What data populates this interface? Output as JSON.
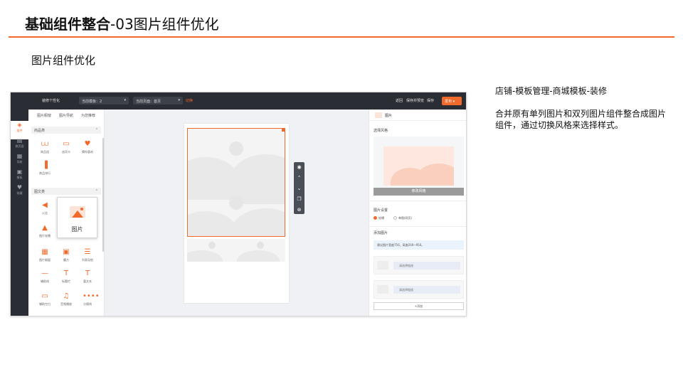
{
  "slide": {
    "title_bold": "基础组件整合",
    "title_rest": "-03图片组件优化",
    "subtitle": "图片组件优化"
  },
  "notes": {
    "path": "店铺-模板管理-商城模板-装修",
    "description": "合并原有单列图片和双列图片组件整合成图片组件，通过切换风格来选择样式。"
  },
  "topbar": {
    "brand": "装修个性化",
    "template_select": "当前模板：2",
    "page_select": "当前页面：首页",
    "switch": "切换",
    "actions": [
      "返回",
      "保存并预览",
      "保存"
    ],
    "publish": "发布 ▾"
  },
  "iconbar": [
    {
      "icon": "cart-icon",
      "label": "组件"
    },
    {
      "icon": "page-icon",
      "label": "微页面"
    },
    {
      "icon": "grid-icon",
      "label": "导航"
    },
    {
      "icon": "mall-icon",
      "label": "模板"
    },
    {
      "icon": "heart-icon",
      "label": "收藏"
    }
  ],
  "component_panel": {
    "tabs": [
      "图片橱窗",
      "图片导航",
      "为您推荐"
    ],
    "group_goods": "商品类",
    "goods_items": [
      "商品组",
      "选项卡",
      "猜你喜欢",
      "商品排行"
    ],
    "group_text": "图文类",
    "text_items": [
      "公告",
      "图片轮播",
      "图片橱窗",
      "魔方",
      "列表导航",
      "辅助线",
      "标题栏",
      "富文本",
      "辅助空白",
      "音频播放",
      "分隔线"
    ],
    "tooltip_label": "图片"
  },
  "props_panel": {
    "header": "图片",
    "style_label": "选择风格",
    "change_style_button": "修改风格",
    "settings_label": "图片设置",
    "radio_options": [
      "轮播",
      "单图(网页)"
    ],
    "add_image_label": "添加图片",
    "size_hint": "建议图片宽度750，高度200~950。",
    "link_placeholder": "请选择链接",
    "add_button": "+添加"
  }
}
